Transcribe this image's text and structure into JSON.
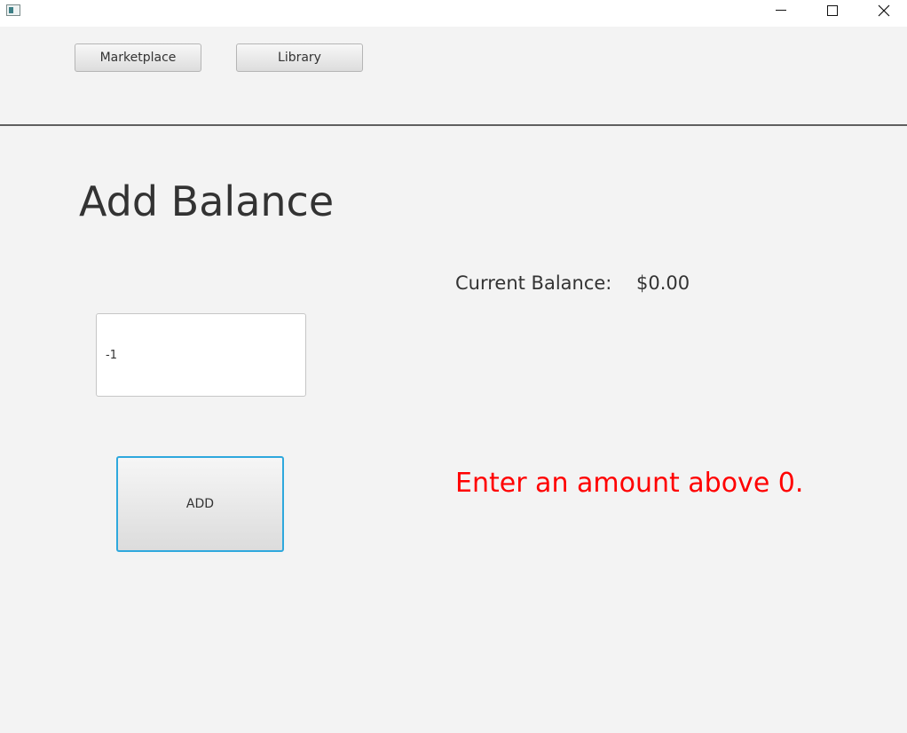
{
  "window": {
    "controls": {
      "minimize_icon": "minimize-icon",
      "maximize_icon": "maximize-icon",
      "close_icon": "close-icon"
    }
  },
  "nav": {
    "marketplace_label": "Marketplace",
    "library_label": "Library"
  },
  "page": {
    "title": "Add Balance"
  },
  "amount_input": {
    "value": "-1"
  },
  "add_button": {
    "label": "ADD"
  },
  "balance": {
    "label": "Current Balance:",
    "value": "$0.00"
  },
  "message": {
    "text": "Enter an amount above 0.",
    "color": "#ff0000"
  },
  "colors": {
    "background": "#f3f3f3",
    "focus_border": "#2ea8dd",
    "error": "#ff0000"
  }
}
